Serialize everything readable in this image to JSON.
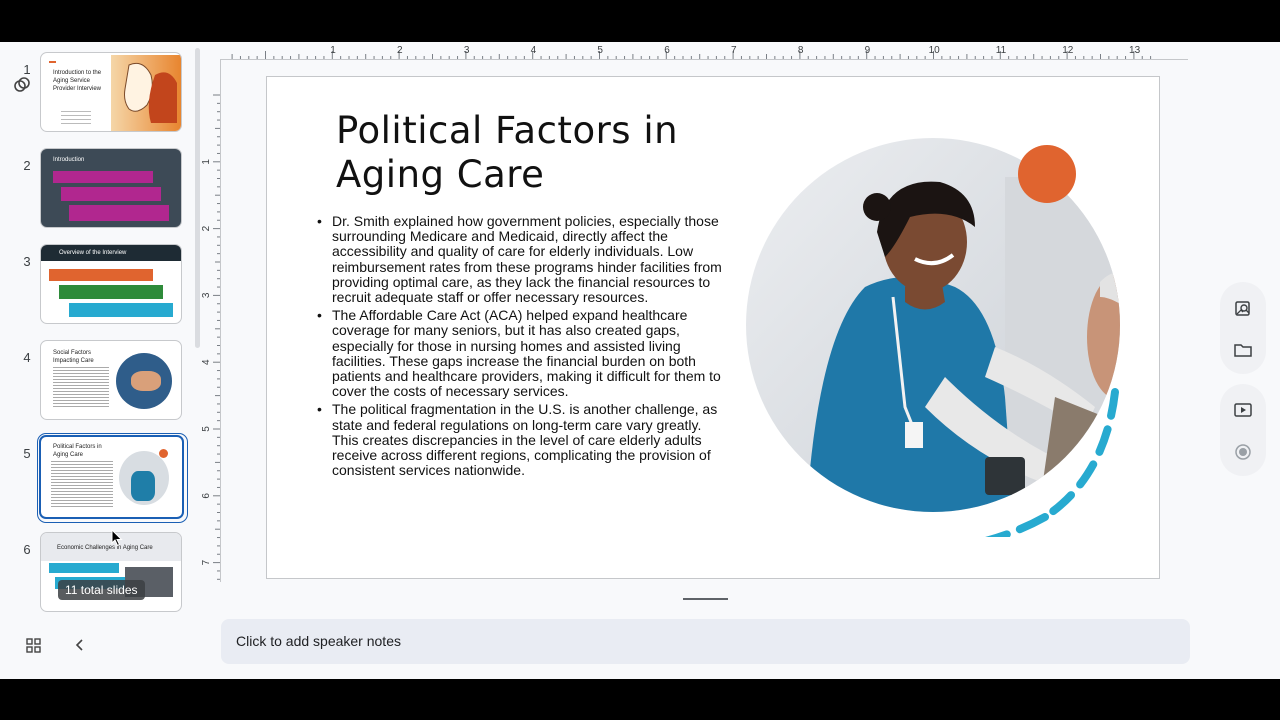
{
  "filmstrip": {
    "slides": [
      {
        "number": "1",
        "title": "Introduction to the Aging Service Provider Interview"
      },
      {
        "number": "2",
        "title": "Introduction"
      },
      {
        "number": "3",
        "title": "Overview of the Interview"
      },
      {
        "number": "4",
        "title": "Social Factors Impacting Care"
      },
      {
        "number": "5",
        "title": "Political Factors in Aging Care"
      },
      {
        "number": "6",
        "title": "Economic Challenges in Aging Care"
      }
    ],
    "total_slides": "11 total slides",
    "selected_slide": 5
  },
  "ruler": {
    "horizontal": [
      "1",
      "2",
      "3",
      "4",
      "5",
      "6",
      "7",
      "8",
      "9",
      "10",
      "11",
      "12",
      "13"
    ],
    "vertical": [
      "1",
      "2",
      "3",
      "4",
      "5",
      "6",
      "7"
    ]
  },
  "slide": {
    "title_line1": "Political Factors in",
    "title_line2": "Aging Care",
    "bullets": [
      "Dr. Smith explained how government policies, especially those surrounding Medicare and Medicaid, directly affect the accessibility and quality of care for elderly individuals. Low reimbursement rates from these programs hinder facilities from providing optimal care, as they lack the financial resources to recruit adequate staff or offer necessary resources.",
      "The Affordable Care Act (ACA) helped expand healthcare coverage for many seniors, but it has also created gaps, especially for those in nursing homes and assisted living facilities. These gaps increase the financial burden on both patients and healthcare providers, making it difficult for them to cover the costs of necessary services.",
      "The political fragmentation in the U.S. is another challenge, as state and federal regulations on long-term care vary greatly. This creates discrepancies in the level of care elderly adults receive across different regions, complicating the provision of consistent services nationwide."
    ],
    "accent_orange": "#e0642f",
    "accent_teal": "#27aad0"
  },
  "notes": {
    "placeholder": "Click to add speaker notes"
  },
  "right_rail": {
    "icons": [
      "image-search-icon",
      "folder-icon",
      "present-icon",
      "record-icon"
    ]
  }
}
